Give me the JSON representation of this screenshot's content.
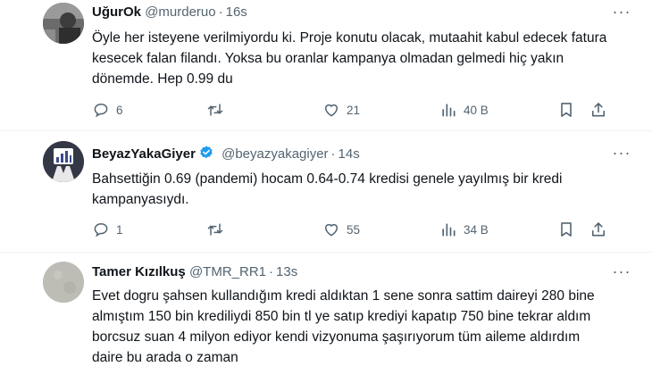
{
  "colors": {
    "text": "#0f1419",
    "secondary": "#536471",
    "verified": "#1d9bf0",
    "divider": "#eff3f4"
  },
  "tweets": [
    {
      "name": "UğurOk",
      "handle": "@murderuo",
      "time": "16s",
      "verified": false,
      "text": "Öyle her isteyene verilmiyordu ki. Proje konutu olacak, mutaahit kabul edecek fatura kesecek falan filandı. Yoksa bu oranlar kampanya olmadan gelmedi hiç yakın dönemde. Hep 0.99 du",
      "replies": "6",
      "retweets": "",
      "likes": "21",
      "views": "40 B"
    },
    {
      "name": "BeyazYakaGiyer",
      "handle": "@beyazyakagiyer",
      "time": "14s",
      "verified": true,
      "text": "Bahsettiğin 0.69 (pandemi) hocam 0.64-0.74 kredisi genele yayılmış bir kredi kampanyasıydı.",
      "replies": "1",
      "retweets": "",
      "likes": "55",
      "views": "34 B"
    },
    {
      "name": "Tamer Kızılkuş",
      "handle": "@TMR_RR1",
      "time": "13s",
      "verified": false,
      "text": "Evet dogru şahsen kullandığım kredi aldıktan 1 sene sonra sattim daireyi 280 bine almıştım 150 bin krediliydi 850 bin tl ye satıp krediyi kapatıp 750 bine tekrar aldım borcsuz suan 4 milyon ediyor kendi vizyonuma şaşırıyorum tüm aileme aldırdım daire bu arada o zaman"
    }
  ]
}
